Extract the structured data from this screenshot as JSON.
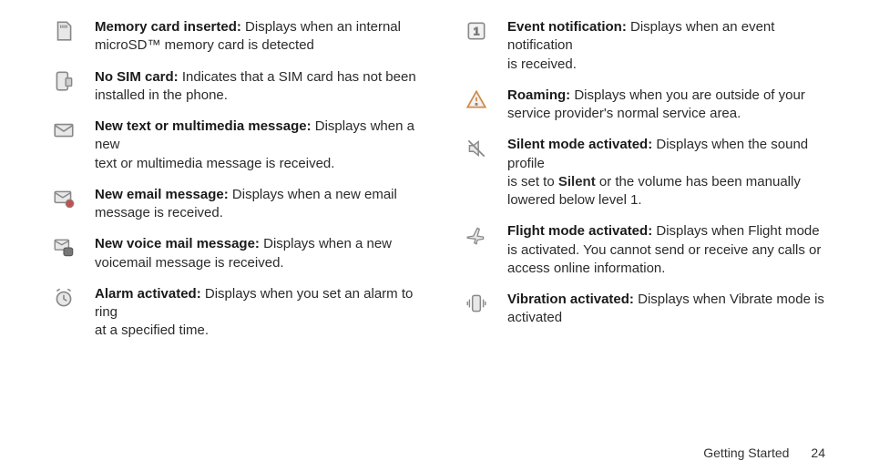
{
  "footer": {
    "section": "Getting Started",
    "page": "24"
  },
  "left": [
    {
      "icon": "memory-card-icon",
      "title": "Memory card inserted:",
      "body1": " Displays when an internal microSD™ memory card is detected"
    },
    {
      "icon": "no-sim-icon",
      "title": "No SIM card:",
      "body1": " Indicates that a SIM card has not been installed in the phone."
    },
    {
      "icon": "new-message-icon",
      "title": "New text or multimedia message:",
      "body1": " Displays when a new",
      "body2": "text or multimedia message is received."
    },
    {
      "icon": "new-email-icon",
      "title": "New email message:",
      "body1": " Displays when a new email message is received."
    },
    {
      "icon": "new-voicemail-icon",
      "title": "New voice mail message:",
      "body1": " Displays when a new voicemail message is received."
    },
    {
      "icon": "alarm-icon",
      "title": "Alarm activated:",
      "body1": " Displays when you set an alarm to ring",
      "body2": "at a specified time."
    }
  ],
  "right": [
    {
      "icon": "event-notification-icon",
      "title": "Event notification:",
      "body1": " Displays when an event notification",
      "body2": "is received."
    },
    {
      "icon": "roaming-icon",
      "title": "Roaming:",
      "body1": " Displays when you are outside of your service provider's normal service area."
    },
    {
      "icon": "silent-mode-icon",
      "title": "Silent mode activated:",
      "body1": " Displays when the sound profile",
      "body2a": "is set to ",
      "bold": "Silent",
      "body2b": " or the volume has been manually lowered below level 1."
    },
    {
      "icon": "flight-mode-icon",
      "title": "Flight mode activated:",
      "body1": " Displays when Flight mode is activated. You cannot send or receive any calls or access online information."
    },
    {
      "icon": "vibration-icon",
      "title": "Vibration activated:",
      "body1": " Displays when Vibrate mode is activated"
    }
  ]
}
